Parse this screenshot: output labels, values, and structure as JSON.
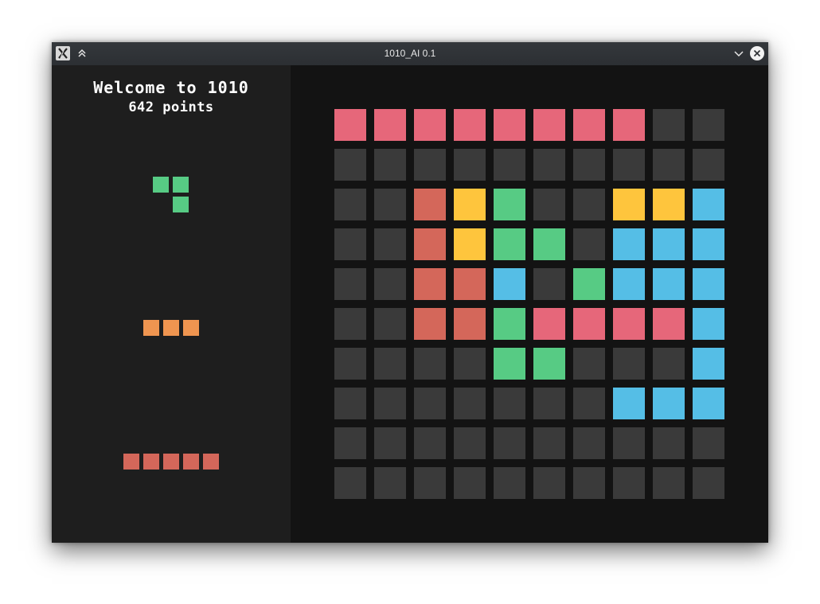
{
  "window": {
    "title": "1010_AI 0.1"
  },
  "sidebar": {
    "welcome": "Welcome to 1010",
    "score": "642 points"
  },
  "colors": {
    "empty": "#3a3a3a",
    "pink": "#e6677a",
    "red": "#d4675a",
    "yellow": "#fec53d",
    "green": "#57cb84",
    "blue": "#55bee6",
    "orange": "#ef9550"
  },
  "pieces": [
    {
      "name": "piece-green-corner",
      "color": "green",
      "cells": [
        [
          0,
          0
        ],
        [
          0,
          1
        ],
        [
          1,
          1
        ]
      ]
    },
    {
      "name": "piece-orange-line-3",
      "color": "orange",
      "cells": [
        [
          0,
          0
        ],
        [
          0,
          1
        ],
        [
          0,
          2
        ]
      ]
    },
    {
      "name": "piece-red-line-5",
      "color": "red",
      "cells": [
        [
          0,
          0
        ],
        [
          0,
          1
        ],
        [
          0,
          2
        ],
        [
          0,
          3
        ],
        [
          0,
          4
        ]
      ]
    }
  ],
  "board": [
    [
      "pink",
      "pink",
      "pink",
      "pink",
      "pink",
      "pink",
      "pink",
      "pink",
      "empty",
      "empty"
    ],
    [
      "empty",
      "empty",
      "empty",
      "empty",
      "empty",
      "empty",
      "empty",
      "empty",
      "empty",
      "empty"
    ],
    [
      "empty",
      "empty",
      "red",
      "yellow",
      "green",
      "empty",
      "empty",
      "yellow",
      "yellow",
      "blue"
    ],
    [
      "empty",
      "empty",
      "red",
      "yellow",
      "green",
      "green",
      "empty",
      "blue",
      "blue",
      "blue"
    ],
    [
      "empty",
      "empty",
      "red",
      "red",
      "blue",
      "empty",
      "green",
      "blue",
      "blue",
      "blue"
    ],
    [
      "empty",
      "empty",
      "red",
      "red",
      "green",
      "pink",
      "pink",
      "pink",
      "pink",
      "blue"
    ],
    [
      "empty",
      "empty",
      "empty",
      "empty",
      "green",
      "green",
      "empty",
      "empty",
      "empty",
      "blue"
    ],
    [
      "empty",
      "empty",
      "empty",
      "empty",
      "empty",
      "empty",
      "empty",
      "blue",
      "blue",
      "blue"
    ],
    [
      "empty",
      "empty",
      "empty",
      "empty",
      "empty",
      "empty",
      "empty",
      "empty",
      "empty",
      "empty"
    ],
    [
      "empty",
      "empty",
      "empty",
      "empty",
      "empty",
      "empty",
      "empty",
      "empty",
      "empty",
      "empty"
    ]
  ]
}
